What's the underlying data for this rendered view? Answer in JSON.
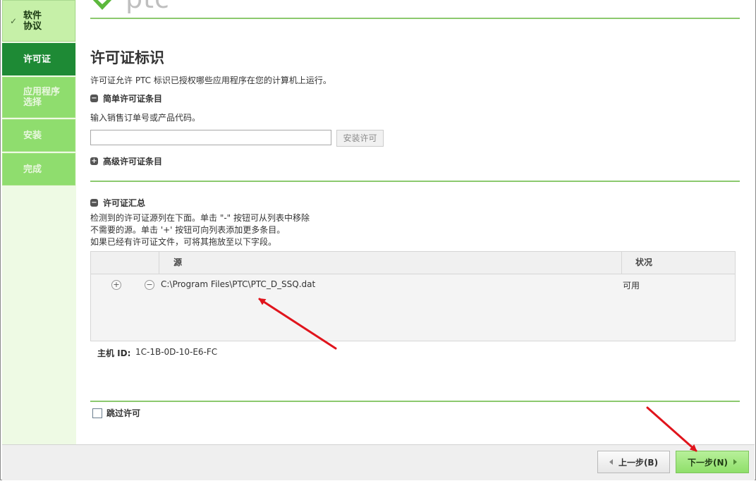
{
  "logo": {
    "text": "ptc"
  },
  "sidebar": {
    "steps": [
      {
        "label": "软件\n协议",
        "state": "done"
      },
      {
        "label": "许可证",
        "state": "active"
      },
      {
        "label": "应用程序\n选择",
        "state": "pending"
      },
      {
        "label": "安装",
        "state": "pending"
      },
      {
        "label": "完成",
        "state": "pending"
      }
    ]
  },
  "main": {
    "title": "许可证标识",
    "description": "许可证允许 PTC 标识已授权哪些应用程序在您的计算机上运行。",
    "simple_section": {
      "title": "简单许可证条目",
      "hint": "输入销售订单号或产品代码。",
      "input_value": "",
      "install_button": "安装许可"
    },
    "advanced_section": {
      "title": "高级许可证条目"
    },
    "summary_section": {
      "title": "许可证汇总",
      "lines": [
        "检测到的许可证源列在下面。单击 \"-\" 按钮可从列表中移除",
        "不需要的源。单击 '+' 按钮可向列表添加更多条目。",
        "如果已经有许可证文件，可将其拖放至以下字段。"
      ],
      "table": {
        "columns": {
          "source": "源",
          "status": "状况"
        },
        "rows": [
          {
            "source": "C:\\Program Files\\PTC\\PTC_D_SSQ.dat",
            "status": "可用"
          }
        ]
      },
      "host_id_label": "主机 ID:",
      "host_id_value": "1C-1B-0D-10-E6-FC"
    },
    "skip_license": {
      "label": "跳过许可",
      "checked": false
    }
  },
  "footer": {
    "back_button": "上一步(B)",
    "next_button": "下一步(N)"
  },
  "colors": {
    "accent_green": "#1e8a35",
    "light_green": "#8fdd6e",
    "annotation_red": "#e0141c"
  }
}
